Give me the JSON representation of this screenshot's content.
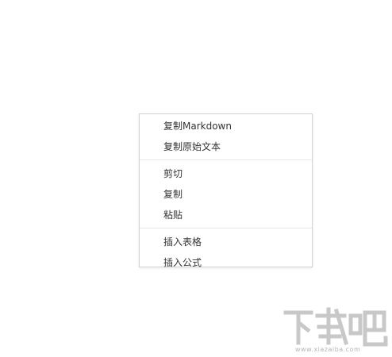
{
  "context_menu": {
    "groups": [
      {
        "items": [
          {
            "label": "复制Markdown"
          },
          {
            "label": "复制原始文本"
          }
        ]
      },
      {
        "items": [
          {
            "label": "剪切"
          },
          {
            "label": "复制"
          },
          {
            "label": "粘贴"
          }
        ]
      },
      {
        "items": [
          {
            "label": "插入表格"
          },
          {
            "label": "插入公式"
          }
        ]
      }
    ]
  },
  "watermark": {
    "text": "下载吧",
    "domain": "www.xiazaiba.com",
    "color": "#c8c8c8"
  }
}
